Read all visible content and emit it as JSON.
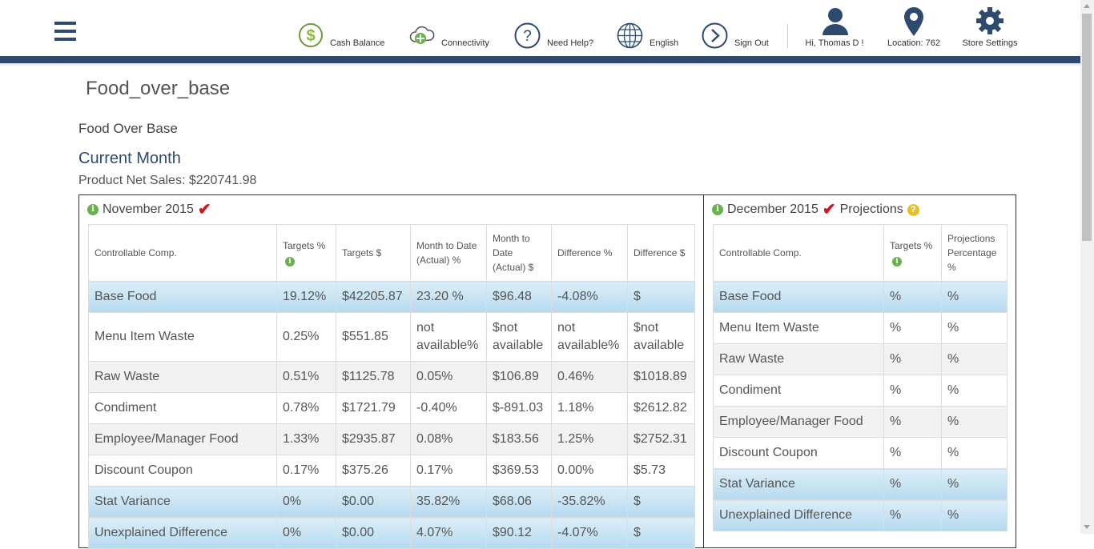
{
  "nav": {
    "cash_balance": "Cash Balance",
    "connectivity": "Connectivity",
    "help": "Need Help?",
    "language": "English",
    "sign_out": "Sign Out",
    "user": "Hi,  Thomas D !",
    "location": "Location: 762",
    "store_settings": "Store Settings"
  },
  "page": {
    "title": "Food_over_base",
    "section": "Food Over Base",
    "period": "Current Month",
    "net_sales_label": "Product Net Sales: ",
    "net_sales_value": "$220741.98"
  },
  "left_panel": {
    "title": "November 2015",
    "columns": [
      "Controllable Comp.",
      "Targets %",
      "Targets $",
      "Month to Date (Actual) %",
      "Month to Date (Actual) $",
      "Difference %",
      "Difference $"
    ],
    "rows": [
      [
        "Base Food",
        "19.12%",
        "$42205.87",
        "23.20 %",
        "$96.48",
        "-4.08%",
        "$"
      ],
      [
        "Menu Item Waste",
        "0.25%",
        "$551.85",
        "not available%",
        "$not available",
        "not available%",
        "$not available"
      ],
      [
        "Raw Waste",
        "0.51%",
        "$1125.78",
        "0.05%",
        "$106.89",
        "0.46%",
        "$1018.89"
      ],
      [
        "Condiment",
        "0.78%",
        "$1721.79",
        "-0.40%",
        "$-891.03",
        "1.18%",
        "$2612.82"
      ],
      [
        "Employee/Manager Food",
        "1.33%",
        "$2935.87",
        "0.08%",
        "$183.56",
        "1.25%",
        "$2752.31"
      ],
      [
        "Discount Coupon",
        "0.17%",
        "$375.26",
        "0.17%",
        "$369.53",
        "0.00%",
        "$5.73"
      ],
      [
        "Stat Variance",
        "0%",
        "$0.00",
        "35.82%",
        "$68.06",
        "-35.82%",
        "$"
      ],
      [
        "Unexplained Difference",
        "0%",
        "$0.00",
        "4.07%",
        "$90.12",
        "-4.07%",
        "$"
      ]
    ]
  },
  "right_panel": {
    "title": "December 2015",
    "subtitle": "Projections",
    "columns": [
      "Controllable Comp.",
      "Targets %",
      "Projections Percentage %"
    ],
    "rows": [
      [
        "Base Food",
        "%",
        "%"
      ],
      [
        "Menu Item Waste",
        "%",
        "%"
      ],
      [
        "Raw Waste",
        "%",
        "%"
      ],
      [
        "Condiment",
        "%",
        "%"
      ],
      [
        "Employee/Manager Food",
        "%",
        "%"
      ],
      [
        "Discount Coupon",
        "%",
        "%"
      ],
      [
        "Stat Variance",
        "%",
        "%"
      ],
      [
        "Unexplained Difference",
        "%",
        "%"
      ]
    ]
  },
  "colors": {
    "brand": "#2e4a6e",
    "highlight_row": "#c6e3f4",
    "check": "#e0101a",
    "info": "#6ab04c"
  }
}
